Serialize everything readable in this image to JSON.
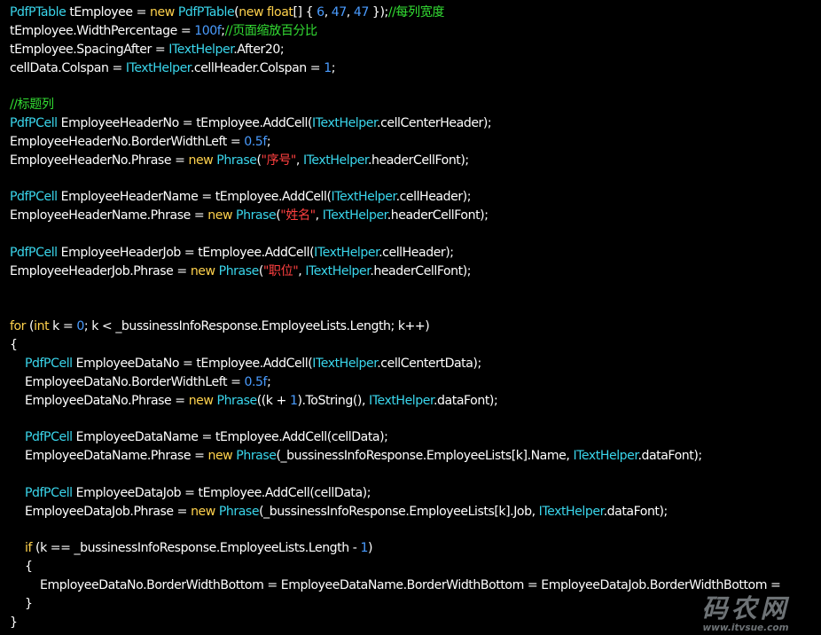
{
  "colors": {
    "background": "#000000",
    "text": "#ffffff",
    "keyword": "#ffd24d",
    "type": "#3ad6ec",
    "number": "#4a9cff",
    "string": "#ff4040",
    "comment": "#33dd33"
  },
  "code_lines": [
    {
      "indent": 0,
      "tokens": [
        [
          "type",
          "PdfPTable"
        ],
        [
          "text",
          " tEmployee = "
        ],
        [
          "keyword",
          "new"
        ],
        [
          "text",
          " "
        ],
        [
          "type",
          "PdfPTable"
        ],
        [
          "text",
          "("
        ],
        [
          "keyword",
          "new"
        ],
        [
          "text",
          " "
        ],
        [
          "keyword",
          "float"
        ],
        [
          "text",
          "[] { "
        ],
        [
          "number",
          "6"
        ],
        [
          "text",
          ", "
        ],
        [
          "number",
          "47"
        ],
        [
          "text",
          ", "
        ],
        [
          "number",
          "47"
        ],
        [
          "text",
          " });"
        ],
        [
          "comment",
          "//每列宽度"
        ]
      ]
    },
    {
      "indent": 0,
      "tokens": [
        [
          "text",
          "tEmployee.WidthPercentage = "
        ],
        [
          "number",
          "100f"
        ],
        [
          "text",
          ";"
        ],
        [
          "comment",
          "//页面缩放百分比"
        ]
      ]
    },
    {
      "indent": 0,
      "tokens": [
        [
          "text",
          "tEmployee.SpacingAfter = "
        ],
        [
          "type",
          "ITextHelper"
        ],
        [
          "text",
          ".After20;"
        ]
      ]
    },
    {
      "indent": 0,
      "tokens": [
        [
          "text",
          "cellData.Colspan = "
        ],
        [
          "type",
          "ITextHelper"
        ],
        [
          "text",
          ".cellHeader.Colspan = "
        ],
        [
          "number",
          "1"
        ],
        [
          "text",
          ";"
        ]
      ]
    },
    {
      "indent": 0,
      "tokens": []
    },
    {
      "indent": 0,
      "tokens": [
        [
          "comment",
          "//标题列"
        ]
      ]
    },
    {
      "indent": 0,
      "tokens": [
        [
          "type",
          "PdfPCell"
        ],
        [
          "text",
          " EmployeeHeaderNo = tEmployee.AddCell("
        ],
        [
          "type",
          "ITextHelper"
        ],
        [
          "text",
          ".cellCenterHeader);"
        ]
      ]
    },
    {
      "indent": 0,
      "tokens": [
        [
          "text",
          "EmployeeHeaderNo.BorderWidthLeft = "
        ],
        [
          "number",
          "0.5f"
        ],
        [
          "text",
          ";"
        ]
      ]
    },
    {
      "indent": 0,
      "tokens": [
        [
          "text",
          "EmployeeHeaderNo.Phrase = "
        ],
        [
          "keyword",
          "new"
        ],
        [
          "text",
          " "
        ],
        [
          "type",
          "Phrase"
        ],
        [
          "text",
          "("
        ],
        [
          "string",
          "\"序号\""
        ],
        [
          "text",
          ", "
        ],
        [
          "type",
          "ITextHelper"
        ],
        [
          "text",
          ".headerCellFont);"
        ]
      ]
    },
    {
      "indent": 0,
      "tokens": []
    },
    {
      "indent": 0,
      "tokens": [
        [
          "type",
          "PdfPCell"
        ],
        [
          "text",
          " EmployeeHeaderName = tEmployee.AddCell("
        ],
        [
          "type",
          "ITextHelper"
        ],
        [
          "text",
          ".cellHeader);"
        ]
      ]
    },
    {
      "indent": 0,
      "tokens": [
        [
          "text",
          "EmployeeHeaderName.Phrase = "
        ],
        [
          "keyword",
          "new"
        ],
        [
          "text",
          " "
        ],
        [
          "type",
          "Phrase"
        ],
        [
          "text",
          "("
        ],
        [
          "string",
          "\"姓名\""
        ],
        [
          "text",
          ", "
        ],
        [
          "type",
          "ITextHelper"
        ],
        [
          "text",
          ".headerCellFont);"
        ]
      ]
    },
    {
      "indent": 0,
      "tokens": []
    },
    {
      "indent": 0,
      "tokens": [
        [
          "type",
          "PdfPCell"
        ],
        [
          "text",
          " EmployeeHeaderJob = tEmployee.AddCell("
        ],
        [
          "type",
          "ITextHelper"
        ],
        [
          "text",
          ".cellHeader);"
        ]
      ]
    },
    {
      "indent": 0,
      "tokens": [
        [
          "text",
          "EmployeeHeaderJob.Phrase = "
        ],
        [
          "keyword",
          "new"
        ],
        [
          "text",
          " "
        ],
        [
          "type",
          "Phrase"
        ],
        [
          "text",
          "("
        ],
        [
          "string",
          "\"职位\""
        ],
        [
          "text",
          ", "
        ],
        [
          "type",
          "ITextHelper"
        ],
        [
          "text",
          ".headerCellFont);"
        ]
      ]
    },
    {
      "indent": 0,
      "tokens": []
    },
    {
      "indent": 0,
      "tokens": []
    },
    {
      "indent": 0,
      "tokens": [
        [
          "keyword",
          "for"
        ],
        [
          "text",
          " ("
        ],
        [
          "keyword",
          "int"
        ],
        [
          "text",
          " k = "
        ],
        [
          "number",
          "0"
        ],
        [
          "text",
          "; k < _bussinessInfoResponse.EmployeeLists.Length; k++)"
        ]
      ]
    },
    {
      "indent": 0,
      "tokens": [
        [
          "text",
          "{"
        ]
      ]
    },
    {
      "indent": 1,
      "tokens": [
        [
          "type",
          "PdfPCell"
        ],
        [
          "text",
          " EmployeeDataNo = tEmployee.AddCell("
        ],
        [
          "type",
          "ITextHelper"
        ],
        [
          "text",
          ".cellCentertData);"
        ]
      ]
    },
    {
      "indent": 1,
      "tokens": [
        [
          "text",
          "EmployeeDataNo.BorderWidthLeft = "
        ],
        [
          "number",
          "0.5f"
        ],
        [
          "text",
          ";"
        ]
      ]
    },
    {
      "indent": 1,
      "tokens": [
        [
          "text",
          "EmployeeDataNo.Phrase = "
        ],
        [
          "keyword",
          "new"
        ],
        [
          "text",
          " "
        ],
        [
          "type",
          "Phrase"
        ],
        [
          "text",
          "((k + "
        ],
        [
          "number",
          "1"
        ],
        [
          "text",
          ").ToString(), "
        ],
        [
          "type",
          "ITextHelper"
        ],
        [
          "text",
          ".dataFont);"
        ]
      ]
    },
    {
      "indent": 0,
      "tokens": []
    },
    {
      "indent": 1,
      "tokens": [
        [
          "type",
          "PdfPCell"
        ],
        [
          "text",
          " EmployeeDataName = tEmployee.AddCell(cellData);"
        ]
      ]
    },
    {
      "indent": 1,
      "tokens": [
        [
          "text",
          "EmployeeDataName.Phrase = "
        ],
        [
          "keyword",
          "new"
        ],
        [
          "text",
          " "
        ],
        [
          "type",
          "Phrase"
        ],
        [
          "text",
          "(_bussinessInfoResponse.EmployeeLists[k].Name, "
        ],
        [
          "type",
          "ITextHelper"
        ],
        [
          "text",
          ".dataFont);"
        ]
      ]
    },
    {
      "indent": 0,
      "tokens": []
    },
    {
      "indent": 1,
      "tokens": [
        [
          "type",
          "PdfPCell"
        ],
        [
          "text",
          " EmployeeDataJob = tEmployee.AddCell(cellData);"
        ]
      ]
    },
    {
      "indent": 1,
      "tokens": [
        [
          "text",
          "EmployeeDataJob.Phrase = "
        ],
        [
          "keyword",
          "new"
        ],
        [
          "text",
          " "
        ],
        [
          "type",
          "Phrase"
        ],
        [
          "text",
          "(_bussinessInfoResponse.EmployeeLists[k].Job, "
        ],
        [
          "type",
          "ITextHelper"
        ],
        [
          "text",
          ".dataFont);"
        ]
      ]
    },
    {
      "indent": 0,
      "tokens": []
    },
    {
      "indent": 1,
      "tokens": [
        [
          "keyword",
          "if"
        ],
        [
          "text",
          " (k == _bussinessInfoResponse.EmployeeLists.Length - "
        ],
        [
          "number",
          "1"
        ],
        [
          "text",
          ")"
        ]
      ]
    },
    {
      "indent": 1,
      "tokens": [
        [
          "text",
          "{"
        ]
      ]
    },
    {
      "indent": 2,
      "tokens": [
        [
          "text",
          "EmployeeDataNo.BorderWidthBottom = EmployeeDataName.BorderWidthBottom = EmployeeDataJob.BorderWidthBottom = "
        ]
      ]
    },
    {
      "indent": 1,
      "tokens": [
        [
          "text",
          "}"
        ]
      ]
    },
    {
      "indent": 0,
      "tokens": [
        [
          "text",
          "}"
        ]
      ]
    }
  ],
  "watermark": {
    "big": "码农网",
    "small": "www.itvsue.com"
  }
}
